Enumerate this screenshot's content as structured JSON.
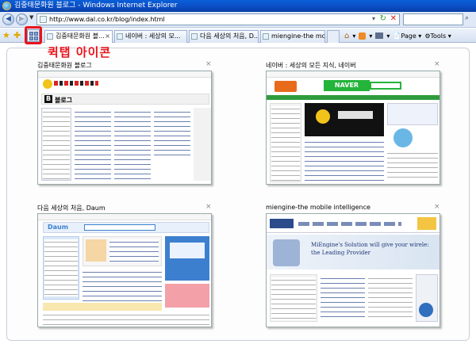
{
  "window": {
    "title": "김중태문화원 블로그 - Windows Internet Explorer"
  },
  "address": {
    "url": "http://www.dal.co.kr/blog/index.html",
    "go_glyph": "▾",
    "refresh_glyph": "↻",
    "stop_glyph": "✕"
  },
  "tabs": [
    {
      "label": "김중태문화원 블...",
      "active": true
    },
    {
      "label": "네이버 : 세상의 모...",
      "active": false
    },
    {
      "label": "다음 세상의 처음, D...",
      "active": false
    },
    {
      "label": "miengine-the mobi...",
      "active": false
    }
  ],
  "toolbar": {
    "page_label": "Page",
    "tools_label": "Tools"
  },
  "annotation": "퀵탭 아이콘",
  "thumbnails": [
    {
      "label": "김중태문화원 블로그",
      "close": "×",
      "site": "blog",
      "heading": "블로그"
    },
    {
      "label": "네이버 : 세상의 모든 지식, 네이버",
      "close": "×",
      "site": "naver",
      "heading": "NAVER"
    },
    {
      "label": "다음 세상의 처음, Daum",
      "close": "×",
      "site": "daum",
      "heading": "Daum"
    },
    {
      "label": "miengine-the mobile intelligence",
      "close": "×",
      "site": "miengine",
      "heading": "MiEngine's Solution will give your wirele: the Leading Provider"
    }
  ],
  "colors": {
    "titlebar": "#0b4cc3",
    "annotation": "#e8141c",
    "naver_green": "#24b43a",
    "daum_blue": "#3d7fcf"
  }
}
